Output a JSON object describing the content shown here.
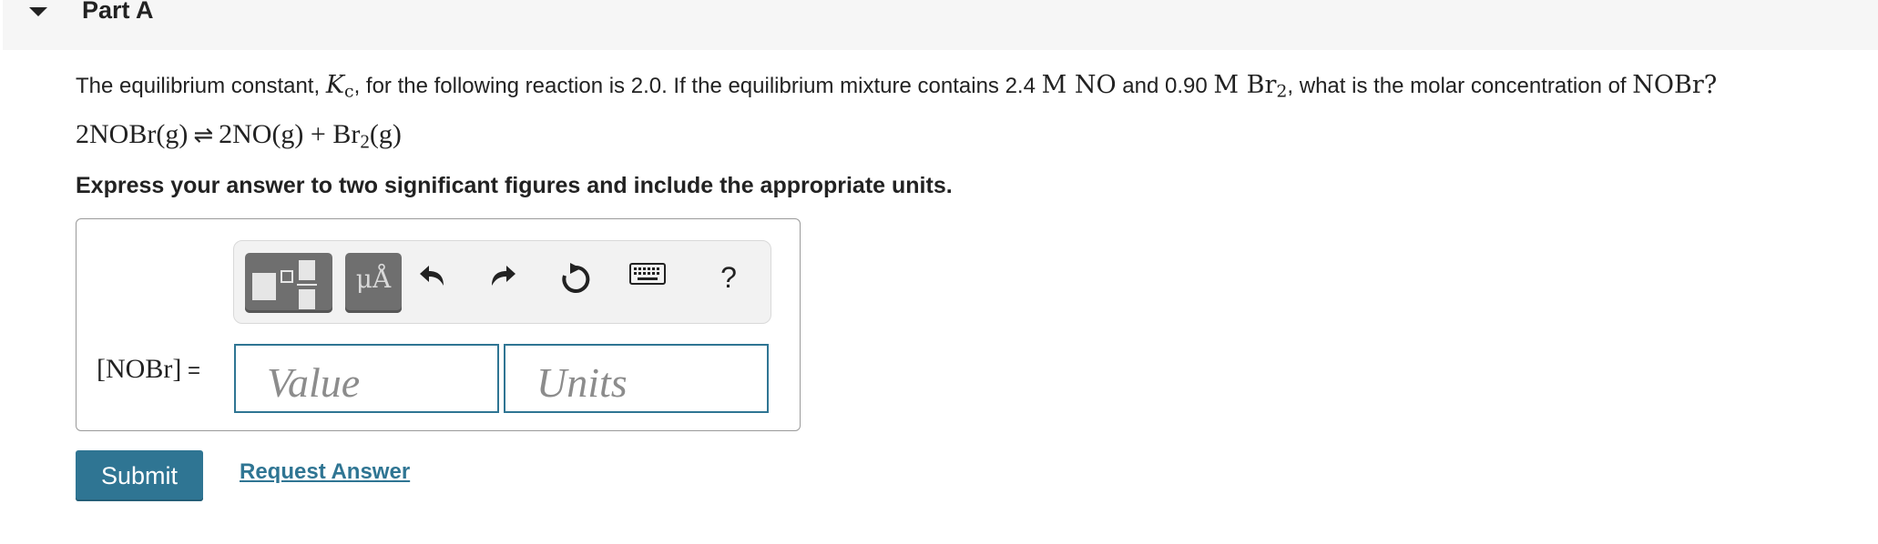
{
  "part": {
    "title": "Part A"
  },
  "question": {
    "text_before_k": "The equilibrium constant, ",
    "k_symbol": "K",
    "k_subscript": "c",
    "text_after_k": ", for the following reaction is 2.0. If the equilibrium mixture contains 2.4 ",
    "no_conc": "M NO",
    "text_and": " and 0.90 ",
    "br2_conc": "M Br",
    "br2_sub": "2",
    "text_end": ", what is the molar concentration of ",
    "target": "NOBr",
    "question_mark": "?"
  },
  "reaction": {
    "left": "2NOBr(g)",
    "right_a": "2NO(g) + Br",
    "right_sub": "2",
    "right_b": "(g)",
    "arrow": "⇌"
  },
  "instruction": "Express your answer to two significant figures and include the appropriate units.",
  "toolbar": {
    "templates_icon": "templates-icon",
    "units_label": "μÅ",
    "undo_icon": "undo-icon",
    "redo_icon": "redo-icon",
    "reset_icon": "reset-icon",
    "keyboard_icon": "keyboard-icon",
    "help_label": "?"
  },
  "answer": {
    "label": "[NOBr]",
    "equals": " =",
    "value_placeholder": "Value",
    "units_placeholder": "Units"
  },
  "actions": {
    "submit_label": "Submit",
    "request_label": "Request Answer"
  },
  "colors": {
    "accent": "#2f7593",
    "toolbar_button": "#6f6f6f",
    "header_bg": "#f6f6f6"
  }
}
